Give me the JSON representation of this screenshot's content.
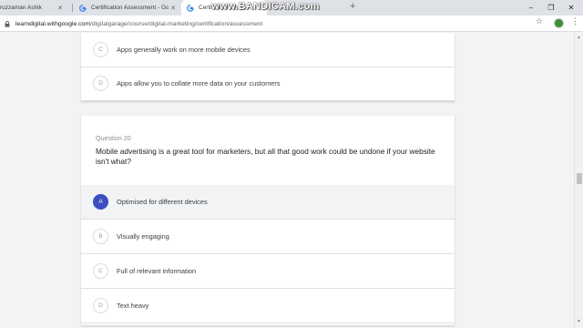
{
  "browser": {
    "tabs": [
      {
        "title": "ruzzaman Ashik",
        "active": false
      },
      {
        "title": "Certification Assessment - Goog",
        "active": false
      },
      {
        "title": "Certification As",
        "active": true
      }
    ],
    "new_tab_symbol": "+",
    "window_controls": {
      "minimize": "–",
      "maximize": "❐",
      "close": "✕"
    },
    "url_host": "learndigital.withgoogle.com",
    "url_path": "/digitalgarage/course/digital-marketing/certification/assessment",
    "watermark": "www.BANDICAM.com"
  },
  "previous_question": {
    "options": [
      {
        "letter": "C",
        "text": "Apps generally work on more mobile devices"
      },
      {
        "letter": "D",
        "text": "Apps allow you to collate more data on your customers"
      }
    ]
  },
  "question": {
    "number_label": "Question 20",
    "text": "Mobile advertising is a great tool for marketers, but all that good work could be undone if your website isn't what?",
    "options": [
      {
        "letter": "A",
        "text": "Optimised for different devices",
        "selected": true
      },
      {
        "letter": "B",
        "text": "Visually engaging",
        "selected": false
      },
      {
        "letter": "C",
        "text": "Full of relevant information",
        "selected": false
      },
      {
        "letter": "D",
        "text": "Text heavy",
        "selected": false
      }
    ]
  },
  "colors": {
    "selected_accent": "#3c4fc1",
    "page_background": "#f1f3f4"
  }
}
